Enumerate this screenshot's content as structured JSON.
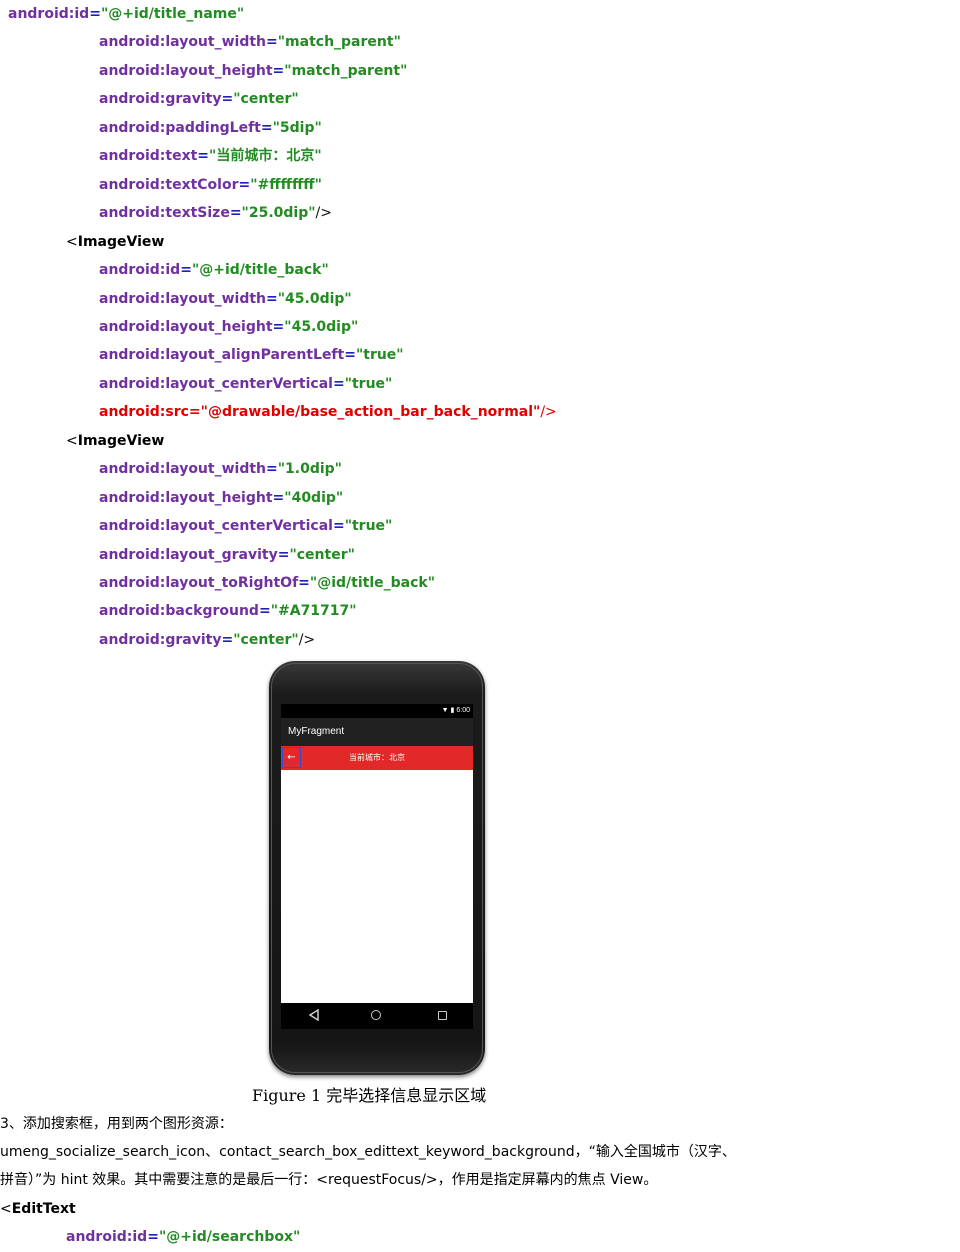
{
  "code_top": [
    {
      "attr": "android:id",
      "val": "\"@+id/title_name\""
    },
    {
      "attr": "android:layout_width",
      "val": "\"match_parent\""
    },
    {
      "attr": "android:layout_height",
      "val": "\"match_parent\""
    },
    {
      "attr": "android:gravity",
      "val": "\"center\""
    },
    {
      "attr": "android:paddingLeft",
      "val": "\"5dip\""
    },
    {
      "attr": "android:text",
      "val": "\"当前城市：北京\""
    },
    {
      "attr": "android:textColor",
      "val": "\"#ffffffff\""
    },
    {
      "attr": "android:textSize",
      "val": "\"25.0dip\"",
      "end": "/>"
    },
    {
      "tag": "ImageView"
    },
    {
      "attr": "android:id",
      "val": "\"@+id/title_back\""
    },
    {
      "attr": "android:layout_width",
      "val": "\"45.0dip\""
    },
    {
      "attr": "android:layout_height",
      "val": "\"45.0dip\""
    },
    {
      "attr": "android:layout_alignParentLeft",
      "val": "\"true\""
    },
    {
      "attr": "android:layout_centerVertical",
      "val": "\"true\""
    },
    {
      "attr": "android:src",
      "val": "\"@drawable/base_action_bar_back_normal\"",
      "end": "/>",
      "red": true
    },
    {
      "tag": "ImageView"
    },
    {
      "attr": "android:layout_width",
      "val": "\"1.0dip\""
    },
    {
      "attr": "android:layout_height",
      "val": "\"40dip\""
    },
    {
      "attr": "android:layout_centerVertical",
      "val": "\"true\""
    },
    {
      "attr": "android:layout_gravity",
      "val": "\"center\""
    },
    {
      "attr": "android:layout_toRightOf",
      "val": "\"@id/title_back\""
    },
    {
      "attr": "android:background",
      "val": "\"#A71717\""
    },
    {
      "attr": "android:gravity",
      "val": "\"center\"",
      "end": "/>"
    }
  ],
  "phone": {
    "status_time": "6:00",
    "app_title": "MyFragment",
    "city_title": "当前城市：北京",
    "back_arrow": "←"
  },
  "caption": "Figure 1 完毕选择信息显示区域",
  "paragraphs": [
    "3、添加搜索框，用到两个图形资源：",
    "umeng_socialize_search_icon、contact_search_box_edittext_keyword_background，“输入全国城市（汉字、",
    "拼音）”为 hint 效果。其中需要注意的是最后一行：<requestFocus/>，作用是指定屏幕内的焦点 View。"
  ],
  "code_bottom": {
    "tag": "EditText",
    "attr": "android:id",
    "val": "\"@+id/searchbox\""
  }
}
